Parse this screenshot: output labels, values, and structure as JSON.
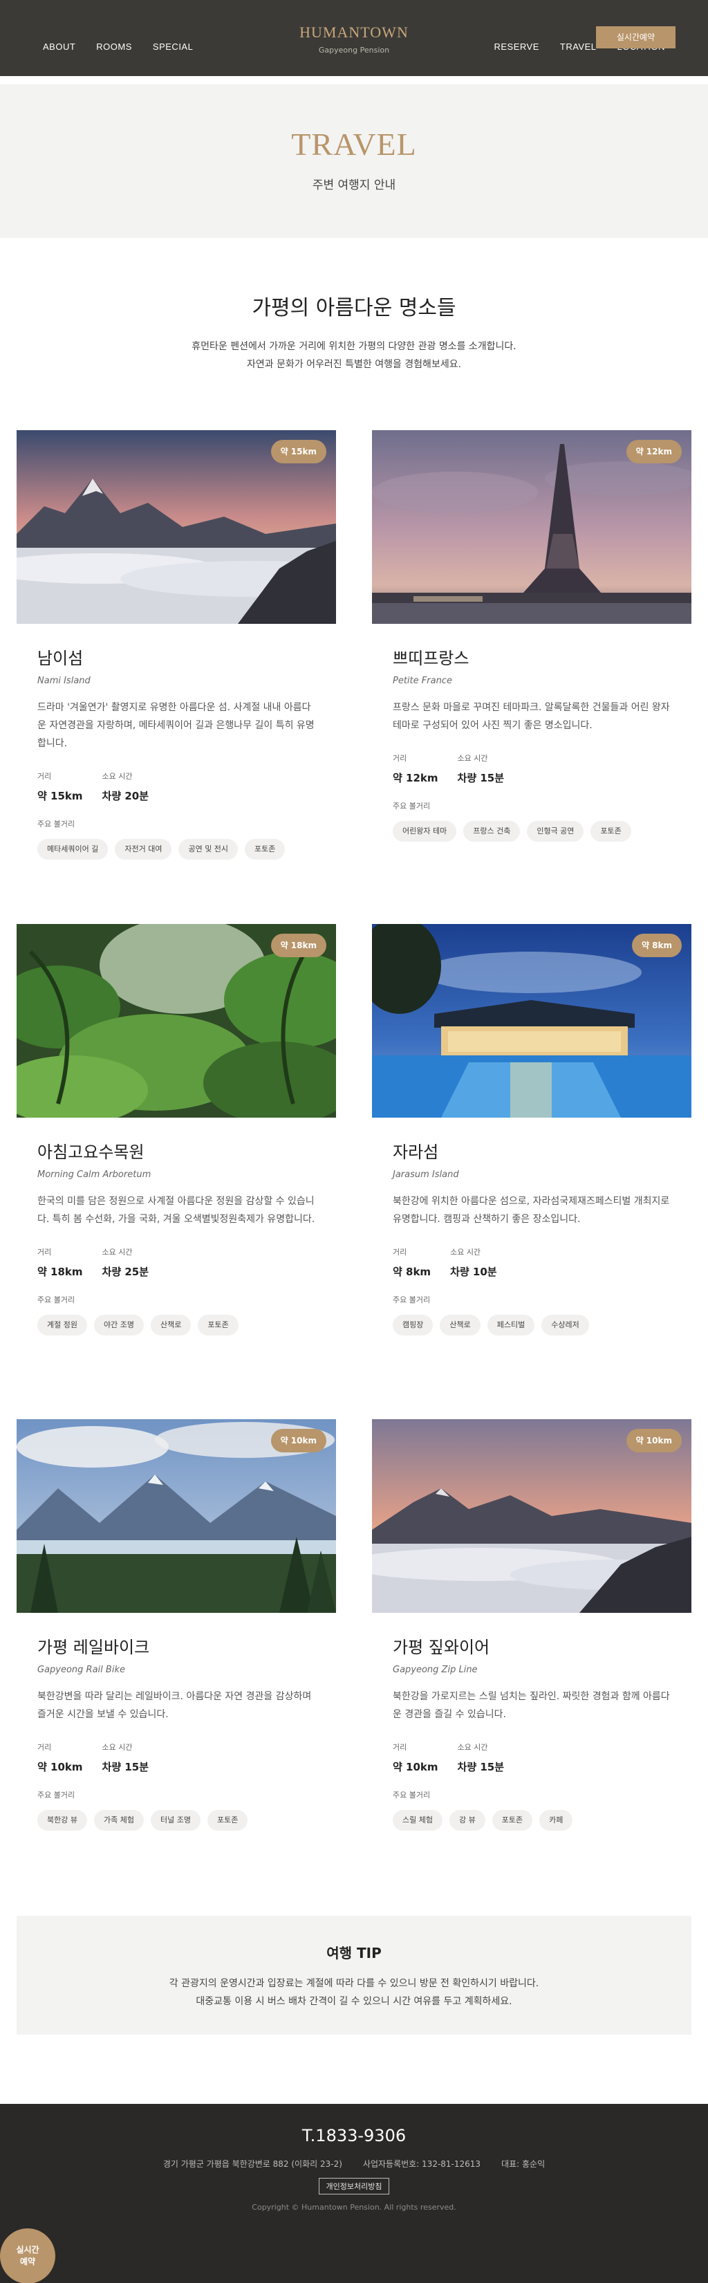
{
  "header": {
    "brand_name": "HUMANTOWN",
    "brand_sub": "Gapyeong Pension",
    "nav_left": [
      "ABOUT",
      "ROOMS",
      "SPECIAL"
    ],
    "nav_right": [
      "RESERVE",
      "TRAVEL",
      "LOCATION"
    ],
    "reserve_button": "실시간예약"
  },
  "hero": {
    "title": "TRAVEL",
    "subtitle": "주변 여행지 안내"
  },
  "intro": {
    "title": "가평의 아름다운 명소들",
    "desc_line1": "휴먼타운 펜션에서 가까운 거리에 위치한 가평의 다양한 관광 명소를 소개합니다.",
    "desc_line2": "자연과 문화가 어우러진 특별한 여행을 경험해보세요."
  },
  "labels": {
    "distance": "거리",
    "time": "소요 시간",
    "nearby": "주요 볼거리"
  },
  "cards": [
    {
      "badge": "약 15km",
      "title": "남이섬",
      "en": "Nami Island",
      "desc": "드라마 '겨울연가' 촬영지로 유명한 아름다운 섬. 사계절 내내 아름다운 자연경관을 자랑하며, 메타세쿼이어 길과 은행나무 길이 특히 유명합니다.",
      "distance": "약 15km",
      "time": "차량 20분",
      "tags": [
        "메타세쿼이어 길",
        "자전거 대여",
        "공연 및 전시",
        "포토존"
      ]
    },
    {
      "badge": "약 12km",
      "title": "쁘띠프랑스",
      "en": "Petite France",
      "desc": "프랑스 문화 마을로 꾸며진 테마파크. 알록달록한 건물들과 어린 왕자 테마로 구성되어 있어 사진 찍기 좋은 명소입니다.",
      "distance": "약 12km",
      "time": "차량 15분",
      "tags": [
        "어린왕자 테마",
        "프랑스 건축",
        "인형극 공연",
        "포토존"
      ]
    },
    {
      "badge": "약 18km",
      "title": "아침고요수목원",
      "en": "Morning Calm Arboretum",
      "desc": "한국의 미를 담은 정원으로 사계절 아름다운 정원을 감상할 수 있습니다. 특히 봄 수선화, 가을 국화, 겨울 오색별빛정원축제가 유명합니다.",
      "distance": "약 18km",
      "time": "차량 25분",
      "tags": [
        "계절 정원",
        "야간 조명",
        "산책로",
        "포토존"
      ]
    },
    {
      "badge": "약 8km",
      "title": "자라섬",
      "en": "Jarasum Island",
      "desc": "북한강에 위치한 아름다운 섬으로, 자라섬국제재즈페스티벌 개최지로 유명합니다. 캠핑과 산책하기 좋은 장소입니다.",
      "distance": "약 8km",
      "time": "차량 10분",
      "tags": [
        "캠핑장",
        "산책로",
        "페스티벌",
        "수상레저"
      ]
    },
    {
      "badge": "약 10km",
      "title": "가평 레일바이크",
      "en": "Gapyeong Rail Bike",
      "desc": "북한강변을 따라 달리는 레일바이크. 아름다운 자연 경관을 감상하며 즐거운 시간을 보낼 수 있습니다.",
      "distance": "약 10km",
      "time": "차량 15분",
      "tags": [
        "북한강 뷰",
        "가족 체험",
        "터널 조명",
        "포토존"
      ]
    },
    {
      "badge": "약 10km",
      "title": "가평 짚와이어",
      "en": "Gapyeong Zip Line",
      "desc": "북한강을 가로지르는 스릴 넘치는 짚라인. 짜릿한 경험과 함께 아름다운 경관을 즐길 수 있습니다.",
      "distance": "약 10km",
      "time": "차량 15분",
      "tags": [
        "스릴 체험",
        "강 뷰",
        "포토존",
        "카페"
      ]
    }
  ],
  "tip": {
    "title": "여행 TIP",
    "line1": "각 관광지의 운영시간과 입장료는 계절에 따라 다를 수 있으니 방문 전 확인하시기 바랍니다.",
    "line2": "대중교통 이용 시 버스 배차 간격이 길 수 있으니 시간 여유를 두고 계획하세요."
  },
  "footer": {
    "phone": "T.1833-9306",
    "address": "경기 가평군 가평읍 북한강변로 882 (이화리 23-2)",
    "biz_no": "사업자등록번호: 132-81-12613",
    "ceo": "대표: 홍순익",
    "policy": "개인정보처리방침",
    "copyright": "Copyright © Humantown Pension. All rights reserved."
  },
  "floating": {
    "line1": "실시간",
    "line2": "예약"
  },
  "colors": {
    "header_bg": "#3b3a36",
    "accent": "#b8956a",
    "footer_bg": "#2a2928",
    "light_bg": "#f3f3f2"
  }
}
